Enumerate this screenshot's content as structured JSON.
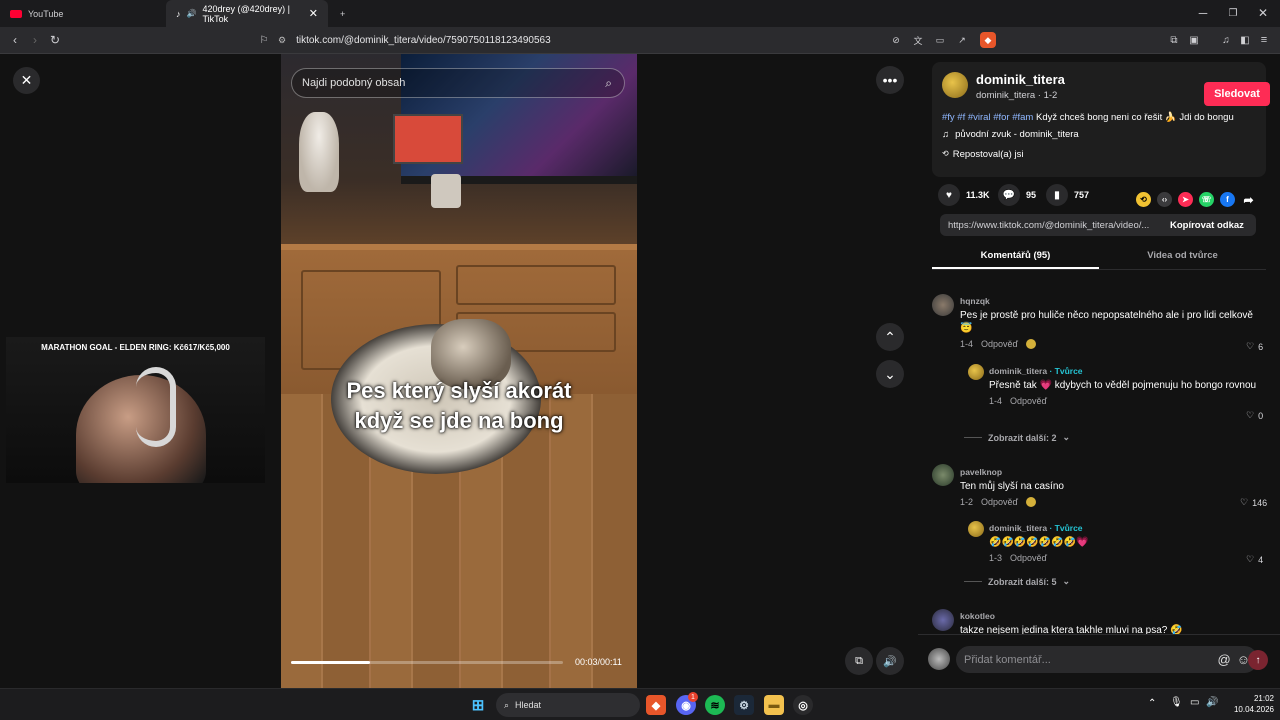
{
  "browser": {
    "tabs": [
      {
        "title": "YouTube"
      },
      {
        "title": "420drey (@420drey) | TikTok"
      }
    ],
    "new_tab": "+",
    "url": "tiktok.com/@dominik_titera/video/7590750118123490563"
  },
  "video": {
    "search_placeholder": "Najdi podobný obsah",
    "caption_line1": "Pes který slyší akorát",
    "caption_line2": "když se jde na bong",
    "time": "00:03/00:11",
    "progress_fraction": 0.29
  },
  "webcam": {
    "banner": "MARATHON GOAL - ELDEN RING: Kč617/Kč5,000"
  },
  "creator": {
    "username": "dominik_titera",
    "subline": "dominik_titera · 1-2",
    "follow_label": "Sledovat",
    "tags": "#fy #f #viral #for #fam",
    "description": " Když chceš bong neni co řešit 🍌 Jdi do bongu",
    "sound": "původní zvuk - dominik_titera",
    "reposted": "Repostoval(a) jsi"
  },
  "stats": {
    "likes": "11.3K",
    "comments": "95",
    "saves": "757"
  },
  "link": {
    "url": "https://www.tiktok.com/@dominik_titera/video/...",
    "copy_label": "Kopírovat odkaz"
  },
  "tabs": {
    "comments": "Komentářů (95)",
    "creator_videos": "Videa od tvůrce"
  },
  "comments": [
    {
      "user": "hqnzqk",
      "text": "Pes je prostě pro huliče něco nepopsatelného ale i pro lidi celkově 😇",
      "date": "1-4",
      "reply": "Odpověď",
      "likes": "6"
    },
    {
      "user": "dominik_titera",
      "creator_badge": " · Tvůrce",
      "text": "Přesně tak 💗 kdybych to věděl pojmenuju ho bongo rovnou",
      "date": "1-4",
      "reply": "Odpověď",
      "likes": "0"
    },
    {
      "more": "Zobrazit další: 2"
    },
    {
      "user": "pavelknop",
      "text": "Ten můj slyší na casíno",
      "date": "1-2",
      "reply": "Odpověď",
      "likes": "146"
    },
    {
      "user": "dominik_titera",
      "creator_badge": " · Tvůrce",
      "text": "🤣🤣🤣🤣🤣🤣🤣💗",
      "date": "1-3",
      "reply": "Odpověď",
      "likes": "4"
    },
    {
      "more": "Zobrazit další: 5"
    },
    {
      "user": "kokotleo",
      "text": "takze nejsem jedina ktera takhle mluvi na psa? 🤣"
    }
  ],
  "compose": {
    "placeholder": "Přidat komentář..."
  },
  "taskbar": {
    "search": "Hledat",
    "time": "21:02",
    "date": "10.04.2026",
    "discord_badge": "1"
  }
}
